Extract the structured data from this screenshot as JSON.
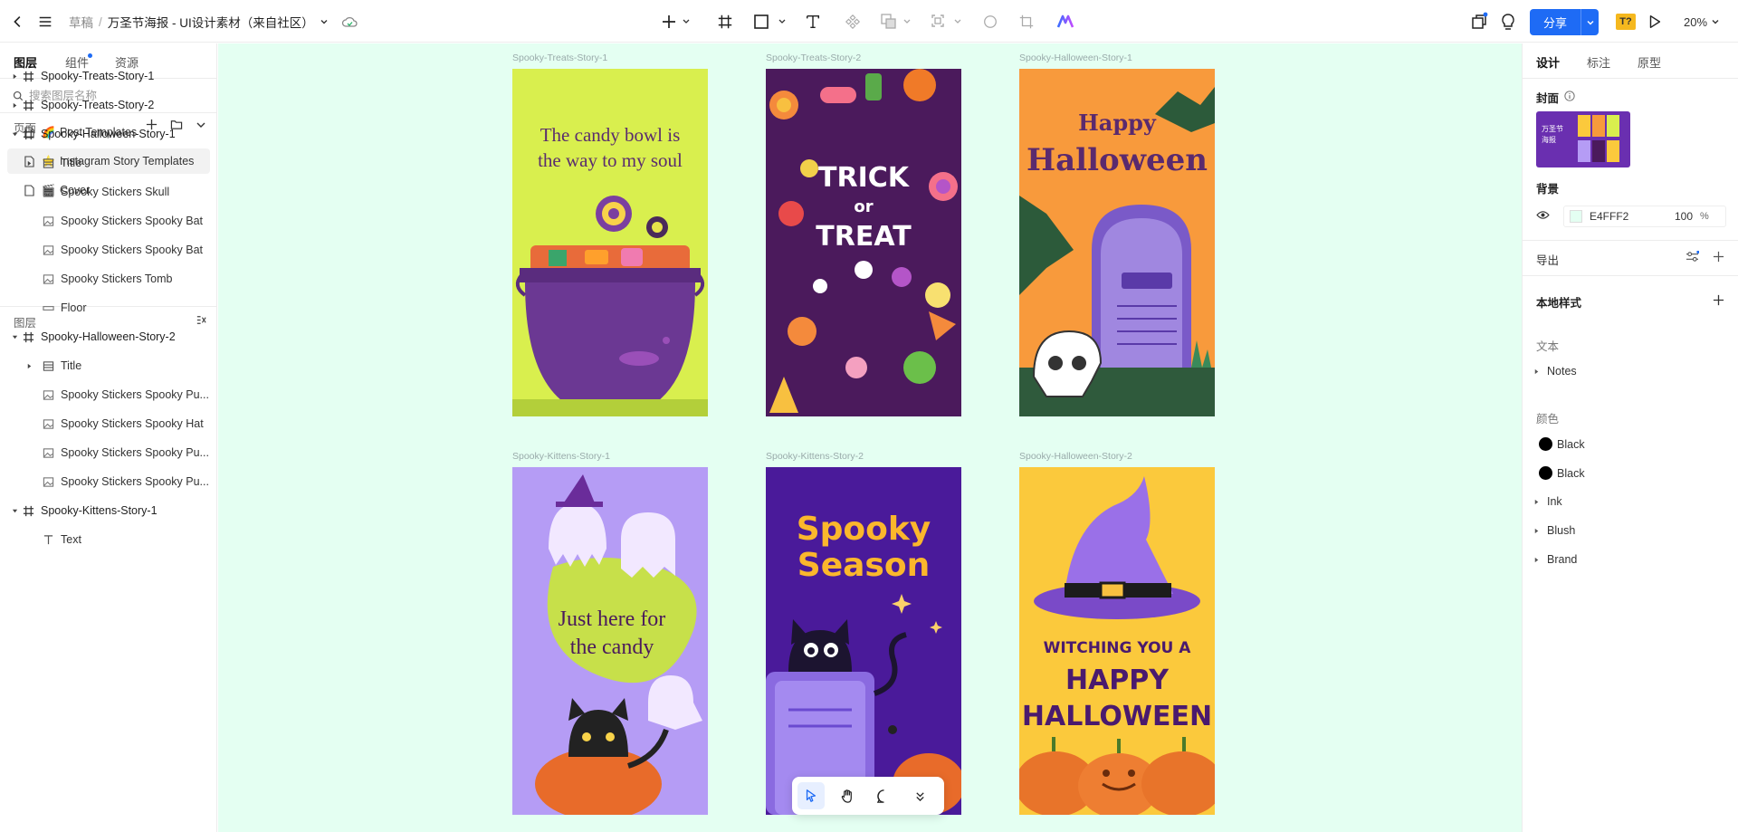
{
  "breadcrumb": {
    "root": "草稿",
    "file": "万圣节海报 - UI设计素材（来自社区）"
  },
  "toolbar": {
    "share_label": "分享",
    "zoom": "20%",
    "font_badge": "T?"
  },
  "left_tabs": [
    "图层",
    "组件",
    "资源"
  ],
  "search": {
    "placeholder": "搜索图层名称"
  },
  "pages_header": "页面",
  "pages": [
    {
      "emoji": "🌈",
      "label": "Post Templates"
    },
    {
      "emoji": "⭐",
      "label": "Instagram Story Templates"
    },
    {
      "emoji": "🎬",
      "label": "Cover"
    }
  ],
  "layers_header": "图层",
  "layers": [
    {
      "label": "Spooky-Treats-Story-1"
    },
    {
      "label": "Spooky-Treats-Story-2"
    },
    {
      "label": "Spooky-Halloween-Story-1"
    },
    {
      "label": "Title"
    },
    {
      "label": "Spooky Stickers Skull"
    },
    {
      "label": "Spooky Stickers Spooky Bat"
    },
    {
      "label": "Spooky Stickers Spooky Bat"
    },
    {
      "label": "Spooky Stickers Tomb"
    },
    {
      "label": "Floor"
    },
    {
      "label": "Spooky-Halloween-Story-2"
    },
    {
      "label": "Title"
    },
    {
      "label": "Spooky Stickers Spooky Pu..."
    },
    {
      "label": "Spooky Stickers Spooky Hat"
    },
    {
      "label": "Spooky Stickers Spooky Pu..."
    },
    {
      "label": "Spooky Stickers Spooky Pu..."
    },
    {
      "label": "Spooky-Kittens-Story-1"
    },
    {
      "label": "Text"
    }
  ],
  "canvas": {
    "background": "#E4FFF2",
    "frames": [
      {
        "label": "Spooky-Treats-Story-1",
        "text": [
          "The candy bowl is",
          "the way to my soul"
        ]
      },
      {
        "label": "Spooky-Treats-Story-2",
        "text": [
          "TRICK",
          "or",
          "TREAT"
        ]
      },
      {
        "label": "Spooky-Halloween-Story-1",
        "text": [
          "Happy",
          "Halloween"
        ]
      },
      {
        "label": "Spooky-Kittens-Story-1",
        "text": [
          "Just here for",
          "the candy"
        ]
      },
      {
        "label": "Spooky-Kittens-Story-2",
        "text": [
          "Spooky",
          "Season"
        ]
      },
      {
        "label": "Spooky-Halloween-Story-2",
        "text": [
          "WITCHING YOU A",
          "HAPPY",
          "HALLOWEEN"
        ]
      }
    ]
  },
  "right_tabs": [
    "设计",
    "标注",
    "原型"
  ],
  "right": {
    "cover_label": "封面",
    "cover_thumb_text": [
      "万圣节",
      "海报"
    ],
    "background_label": "背景",
    "bg_hex": "E4FFF2",
    "bg_opacity": "100",
    "bg_opacity_unit": "%",
    "export_label": "导出",
    "local_styles_label": "本地样式",
    "text_section": "文本",
    "text_styles": [
      "Notes"
    ],
    "color_section": "颜色",
    "colors": [
      {
        "name": "Black",
        "hex": "#000000"
      },
      {
        "name": "Black",
        "hex": "#000000"
      }
    ],
    "color_groups": [
      "Ink",
      "Blush",
      "Brand"
    ]
  }
}
